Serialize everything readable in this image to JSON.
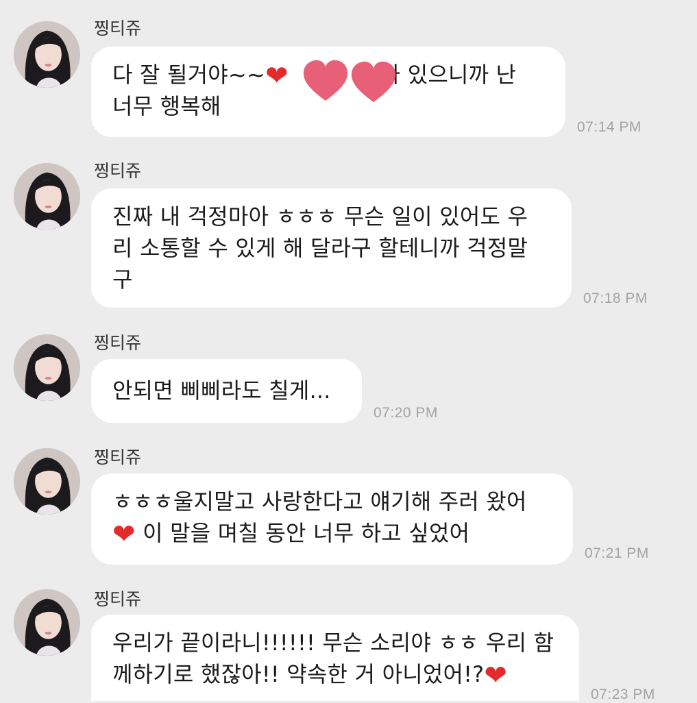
{
  "colors": {
    "background": "#ececec",
    "bubble": "#ffffff",
    "time": "#a3a3a3",
    "heart": "#e32b2b",
    "censor_heart": "#e85f78"
  },
  "messages": [
    {
      "sender": "찡티쥬",
      "lines": [
        "다 잘 될거야~~",
        "가 있으니까 난",
        "너무 행복해"
      ],
      "time": "07:14 PM"
    },
    {
      "sender": "찡티쥬",
      "lines": [
        "진짜 내 걱정마아 ㅎㅎㅎ 무슨 일이 있어도 우",
        "리 소통할 수 있게 해 달라구 할테니까 걱정말",
        "구"
      ],
      "time": "07:18 PM"
    },
    {
      "sender": "찡티쥬",
      "lines": [
        "안되면 삐삐라도 칠게..."
      ],
      "time": "07:20 PM"
    },
    {
      "sender": "찡티쥬",
      "lines": [
        "ㅎㅎㅎ울지말고 사랑한다고 얘기해 주러 왔어",
        "이 말을 며칠 동안 너무 하고 싶었어"
      ],
      "time": "07:21 PM"
    },
    {
      "sender": "찡티쥬",
      "lines": [
        "우리가 끝이라니!!!!!! 무슨 소리야 ㅎㅎ 우리 함",
        "께하기로 했잖아!! 약속한 거 아니었어!?"
      ],
      "time": "07:23 PM"
    }
  ]
}
